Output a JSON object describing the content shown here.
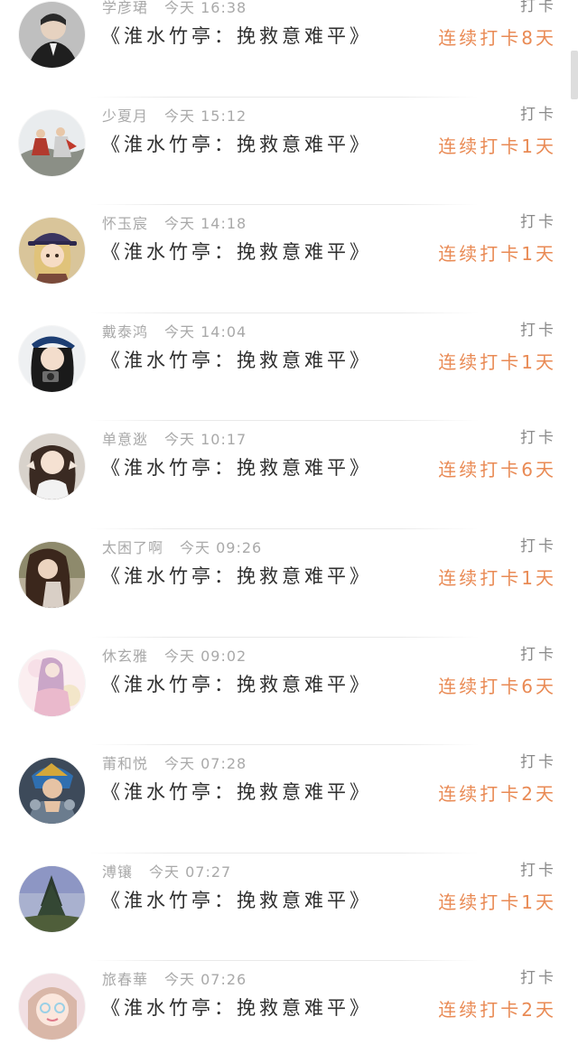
{
  "action_label": "打卡",
  "entries": [
    {
      "name": "学彦珺",
      "time": "今天 16:38",
      "title": "《淮水竹亭：挽救意难平》",
      "streak": "连续打卡8天",
      "avatar_icon": "man-in-suit-avatar"
    },
    {
      "name": "少夏月",
      "time": "今天 15:12",
      "title": "《淮水竹亭：挽救意难平》",
      "streak": "连续打卡1天",
      "avatar_icon": "costume-figures-avatar"
    },
    {
      "name": "怀玉宸",
      "time": "今天 14:18",
      "title": "《淮水竹亭：挽救意难平》",
      "streak": "连续打卡1天",
      "avatar_icon": "cartoon-girl-hat-avatar"
    },
    {
      "name": "戴泰鸿",
      "time": "今天 14:04",
      "title": "《淮水竹亭：挽救意难平》",
      "streak": "连续打卡1天",
      "avatar_icon": "girl-with-camera-avatar"
    },
    {
      "name": "单意逖",
      "time": "今天 10:17",
      "title": "《淮水竹亭：挽救意难平》",
      "streak": "连续打卡6天",
      "avatar_icon": "girl-portrait-avatar"
    },
    {
      "name": "太困了啊",
      "time": "今天 09:26",
      "title": "《淮水竹亭：挽救意难平》",
      "streak": "连续打卡1天",
      "avatar_icon": "long-hair-girl-avatar"
    },
    {
      "name": "休玄雅",
      "time": "今天 09:02",
      "title": "《淮水竹亭：挽救意难平》",
      "streak": "连续打卡6天",
      "avatar_icon": "pink-illustration-avatar"
    },
    {
      "name": "莆和悦",
      "time": "今天 07:28",
      "title": "《淮水竹亭：挽救意难平》",
      "streak": "连续打卡2天",
      "avatar_icon": "game-character-avatar"
    },
    {
      "name": "溥镶",
      "time": "今天 07:27",
      "title": "《淮水竹亭：挽救意难平》",
      "streak": "连续打卡1天",
      "avatar_icon": "tree-landscape-avatar"
    },
    {
      "name": "旅春華",
      "time": "今天 07:26",
      "title": "《淮水竹亭：挽救意难平》",
      "streak": "连续打卡2天",
      "avatar_icon": "cute-face-avatar"
    }
  ],
  "colors": {
    "streak": "#e98a54",
    "meta": "#a9a9a9",
    "title": "#2f2f2f",
    "action": "#8a8a8a"
  }
}
